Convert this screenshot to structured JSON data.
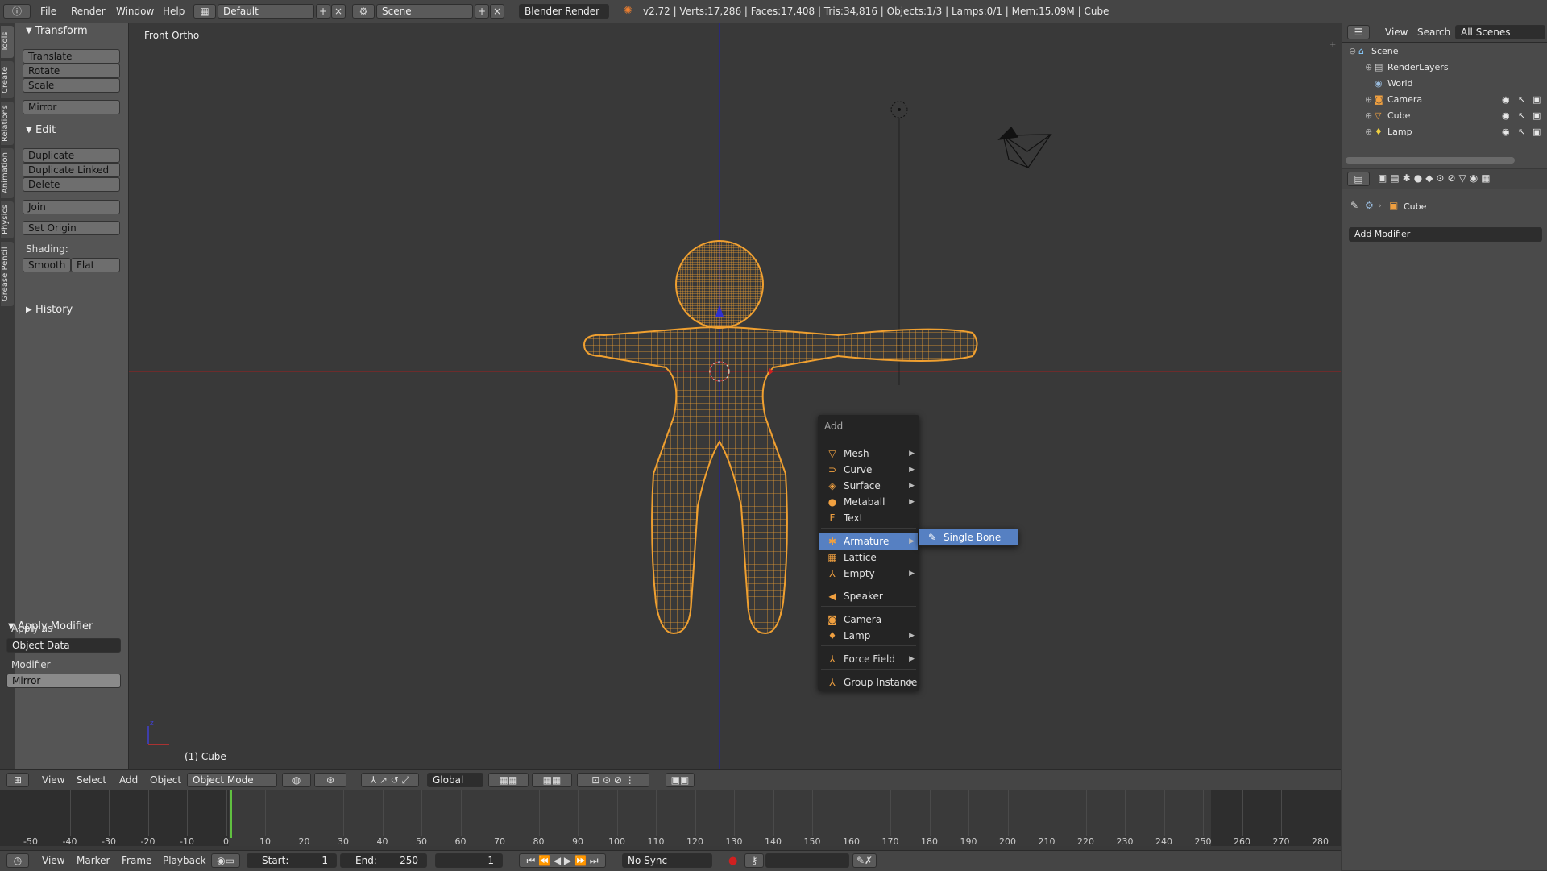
{
  "topbar": {
    "menus": [
      "File",
      "Render",
      "Window",
      "Help"
    ],
    "layout": "Default",
    "scene": "Scene",
    "engine": "Blender Render",
    "stats": "v2.72 | Verts:17,286 | Faces:17,408 | Tris:34,816 | Objects:1/3 | Lamps:0/1 | Mem:15.09M | Cube"
  },
  "tabstrip": [
    "Tools",
    "Create",
    "Relations",
    "Animation",
    "Physics",
    "Grease Pencil"
  ],
  "toolshelf": {
    "transform_header": "Transform",
    "transform_buttons": [
      "Translate",
      "Rotate",
      "Scale"
    ],
    "mirror": "Mirror",
    "edit_header": "Edit",
    "edit_buttons": [
      "Duplicate",
      "Duplicate Linked",
      "Delete"
    ],
    "join": "Join",
    "set_origin": "Set Origin",
    "shading_label": "Shading:",
    "smooth": "Smooth",
    "flat": "Flat",
    "history_header": "History",
    "apply_header": "Apply Modifier",
    "apply_as_label": "Apply as",
    "apply_as_value": "Object Data",
    "modifier_label": "Modifier",
    "modifier_value": "Mirror"
  },
  "viewport": {
    "view_name": "Front Ortho",
    "object_label": "(1) Cube"
  },
  "addmenu": {
    "title": "Add",
    "items": [
      {
        "label": "Mesh",
        "icon": "mesh-icon",
        "glyph": "▽",
        "sub": true
      },
      {
        "label": "Curve",
        "icon": "curve-icon",
        "glyph": "⊃",
        "sub": true
      },
      {
        "label": "Surface",
        "icon": "surface-icon",
        "glyph": "◈",
        "sub": true
      },
      {
        "label": "Metaball",
        "icon": "metaball-icon",
        "glyph": "●",
        "sub": true
      },
      {
        "label": "Text",
        "icon": "text-icon",
        "glyph": "F",
        "sub": false
      },
      {
        "label": "Armature",
        "icon": "armature-icon",
        "glyph": "✱",
        "sub": true,
        "active": true
      },
      {
        "label": "Lattice",
        "icon": "lattice-icon",
        "glyph": "▦",
        "sub": false
      },
      {
        "label": "Empty",
        "icon": "empty-icon",
        "glyph": "⅄",
        "sub": true
      },
      {
        "label": "Speaker",
        "icon": "speaker-icon",
        "glyph": "◀",
        "sub": false
      },
      {
        "label": "Camera",
        "icon": "camera-icon",
        "glyph": "◙",
        "sub": false
      },
      {
        "label": "Lamp",
        "icon": "lamp-icon",
        "glyph": "♦",
        "sub": true
      },
      {
        "label": "Force Field",
        "icon": "force-field-icon",
        "glyph": "⅄",
        "sub": true
      },
      {
        "label": "Group Instance",
        "icon": "group-instance-icon",
        "glyph": "⅄",
        "sub": true
      }
    ],
    "submenu_item": "Single Bone"
  },
  "outliner": {
    "menus": [
      "View",
      "Search"
    ],
    "scope": "All Scenes",
    "rows": [
      {
        "label": "Scene"
      },
      {
        "label": "RenderLayers"
      },
      {
        "label": "World"
      },
      {
        "label": "Camera"
      },
      {
        "label": "Cube"
      },
      {
        "label": "Lamp"
      }
    ]
  },
  "properties": {
    "breadcrumb": "Cube",
    "add_modifier": "Add Modifier"
  },
  "view3d_header": {
    "menus": [
      "View",
      "Select",
      "Add",
      "Object"
    ],
    "mode": "Object Mode",
    "orientation": "Global"
  },
  "timeline": {
    "ticks": [
      "-50",
      "-40",
      "-30",
      "-20",
      "-10",
      "0",
      "10",
      "20",
      "30",
      "40",
      "50",
      "60",
      "70",
      "80",
      "90",
      "100",
      "110",
      "120",
      "130",
      "140",
      "150",
      "160",
      "170",
      "180",
      "190",
      "200",
      "210",
      "220",
      "230",
      "240",
      "250",
      "260",
      "270",
      "280"
    ],
    "current_frame_tick": "0"
  },
  "timeline_header": {
    "menus": [
      "View",
      "Marker",
      "Frame",
      "Playback"
    ],
    "start": "Start:",
    "start_value": "1",
    "end": "End:",
    "end_value": "250",
    "frame": "1",
    "sync": "No Sync"
  },
  "colors": {
    "mesh": "#f0a030",
    "active_menu": "#5680c2",
    "x_axis": "#a02020",
    "z_axis": "#2020a0"
  }
}
